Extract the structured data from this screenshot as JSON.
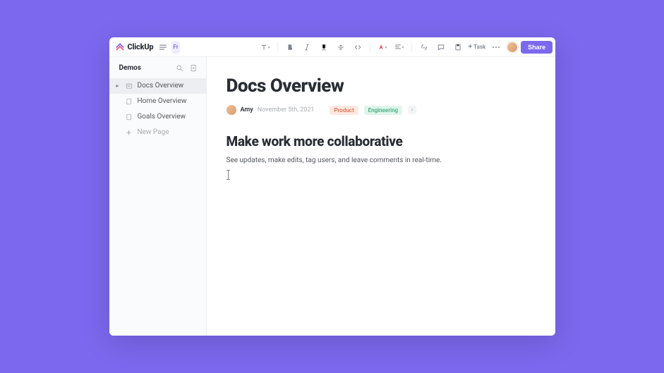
{
  "brand": "ClickUp",
  "sidebar_collapse_label": "Fr",
  "toolbar": {
    "task_label": "Task",
    "share_label": "Share"
  },
  "sidebar": {
    "title": "Demos",
    "items": [
      {
        "label": "Docs Overview",
        "active": true,
        "expandable": true
      },
      {
        "label": "Home Overview",
        "active": false,
        "expandable": false
      },
      {
        "label": "Goals Overview",
        "active": false,
        "expandable": false
      }
    ],
    "new_page_label": "New Page"
  },
  "doc": {
    "title": "Docs Overview",
    "author": "Amy",
    "date": "November 5th, 2021",
    "tags": [
      {
        "label": "Product",
        "kind": "product"
      },
      {
        "label": "Engineering",
        "kind": "eng"
      }
    ],
    "heading": "Make work more collaborative",
    "paragraph": "See updates, make edits, tag users, and leave comments in real-time."
  }
}
